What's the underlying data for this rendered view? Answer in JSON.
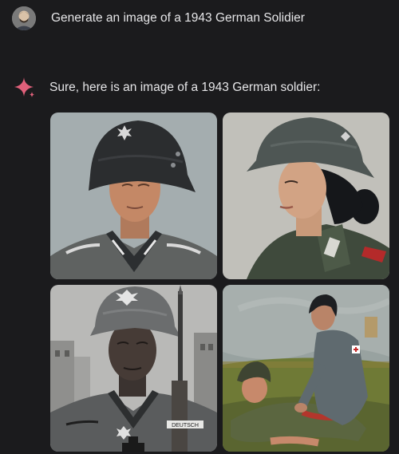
{
  "conversation": {
    "user_message": "Generate an image of a 1943 German Solidier",
    "assistant_message": "Sure, here is an image of a 1943 German soldier:"
  },
  "images": [
    {
      "label": "generated-image-1"
    },
    {
      "label": "generated-image-2"
    },
    {
      "label": "generated-image-3",
      "visible_text": "DEUTSCH"
    },
    {
      "label": "generated-image-4"
    }
  ],
  "icons": {
    "avatar": "user-avatar",
    "assistant": "sparkle-icon"
  },
  "colors": {
    "background": "#1b1b1d",
    "text": "#e6e6e8",
    "sparkle_accent": "#e0607a"
  }
}
